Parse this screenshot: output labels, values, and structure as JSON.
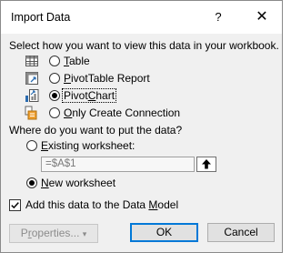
{
  "window": {
    "title": "Import Data",
    "help_glyph": "?",
    "close_glyph": "✕"
  },
  "view_section": {
    "prompt": "Select how you want to view this data in your workbook.",
    "options": [
      {
        "prefix": "",
        "underlined": "T",
        "rest": "able",
        "checked": false,
        "icon": "table-icon"
      },
      {
        "prefix": "",
        "underlined": "P",
        "rest": "ivotTable Report",
        "checked": false,
        "icon": "pivottable-icon"
      },
      {
        "prefix": "Pivot",
        "underlined": "C",
        "rest": "hart",
        "checked": true,
        "icon": "pivotchart-icon"
      },
      {
        "prefix": "",
        "underlined": "O",
        "rest": "nly Create Connection",
        "checked": false,
        "icon": "connection-icon"
      }
    ]
  },
  "location_section": {
    "prompt": "Where do you want to put the data?",
    "existing": {
      "prefix": "",
      "underlined": "E",
      "rest": "xisting worksheet:",
      "checked": false
    },
    "cell_reference": "=$A$1",
    "new": {
      "prefix": "",
      "underlined": "N",
      "rest": "ew worksheet",
      "checked": true
    }
  },
  "data_model": {
    "prefix": "Add this data to the Data ",
    "underlined": "M",
    "rest": "odel",
    "checked": true
  },
  "buttons": {
    "properties": {
      "prefix": "P",
      "underlined": "r",
      "rest": "operties...",
      "arrow": "▾"
    },
    "ok": "OK",
    "cancel": "Cancel"
  },
  "colors": {
    "title_bg": "#ffffff",
    "body_bg": "#f0f0f0",
    "default_button_border": "#0078d7"
  }
}
